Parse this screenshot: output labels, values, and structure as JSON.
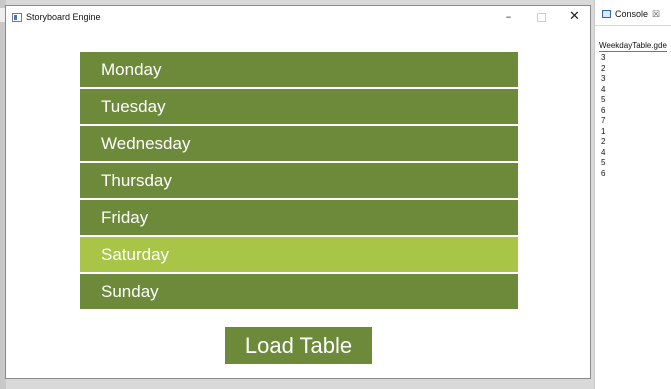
{
  "window": {
    "title": "Storyboard Engine",
    "minimize_glyph": "–",
    "close_glyph": "✕"
  },
  "days": [
    {
      "label": "Monday",
      "selected": false
    },
    {
      "label": "Tuesday",
      "selected": false
    },
    {
      "label": "Wednesday",
      "selected": false
    },
    {
      "label": "Thursday",
      "selected": false
    },
    {
      "label": "Friday",
      "selected": false
    },
    {
      "label": "Saturday",
      "selected": true
    },
    {
      "label": "Sunday",
      "selected": false
    }
  ],
  "load_button": {
    "label": "Load Table"
  },
  "console": {
    "tab_label": "Console",
    "close_glyph": "☒",
    "file_label": "WeekdayTable.gde",
    "lines": [
      "3",
      "2",
      "3",
      "4",
      "5",
      "6",
      "7",
      "1",
      "2",
      "4",
      "5",
      "6"
    ]
  },
  "colors": {
    "row": "#6d8a3a",
    "row_selected": "#a8c548",
    "text": "#ffffff"
  }
}
